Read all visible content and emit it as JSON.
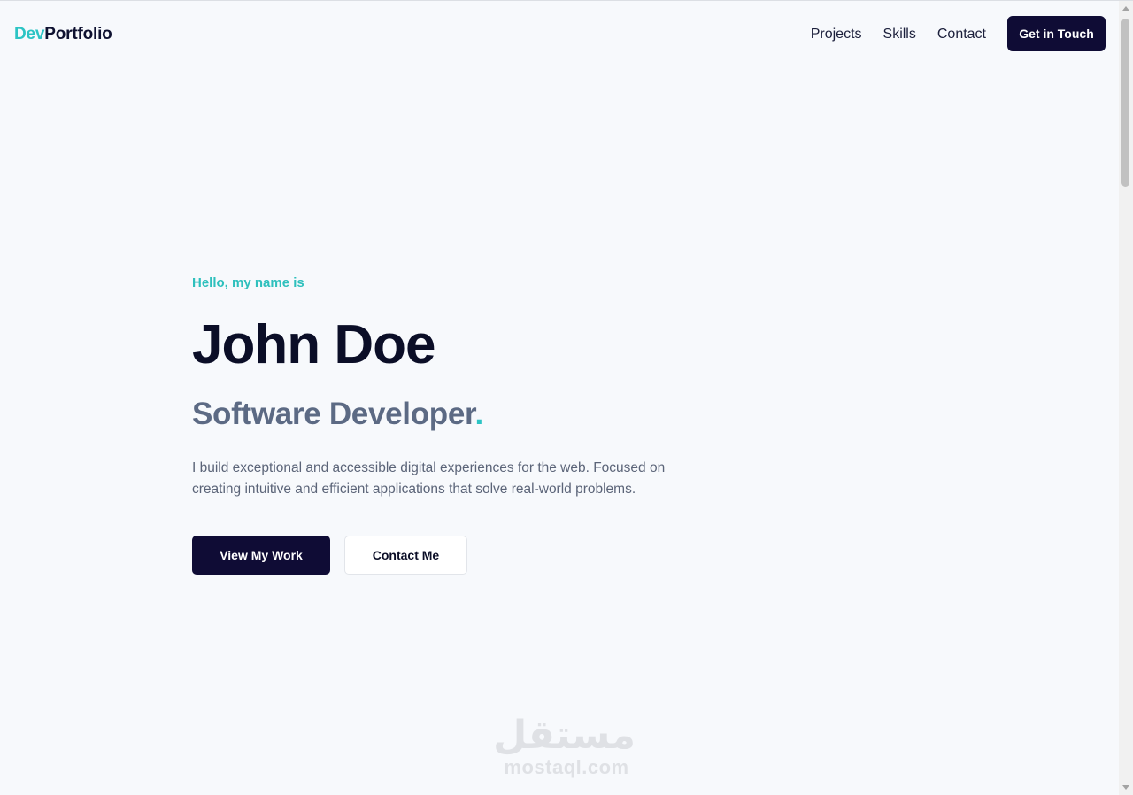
{
  "navbar": {
    "logo_accent": "Dev",
    "logo_main": "Portfolio",
    "links": [
      {
        "label": "Projects"
      },
      {
        "label": "Skills"
      },
      {
        "label": "Contact"
      }
    ],
    "cta_label": "Get in Touch"
  },
  "hero": {
    "greeting": "Hello, my name is",
    "name": "John Doe",
    "role": "Software Developer",
    "role_dot": ".",
    "bio": "I build exceptional and accessible digital experiences for the web. Focused on creating intuitive and efficient applications that solve real-world problems.",
    "primary_button": "View My Work",
    "secondary_button": "Contact Me"
  },
  "watermark": {
    "logo_text": "مستقل",
    "url": "mostaql.com"
  },
  "colors": {
    "accent": "#2cc4c4",
    "primary": "#0f0c35",
    "background": "#f7f9fc",
    "muted_text": "#5c6a84"
  }
}
